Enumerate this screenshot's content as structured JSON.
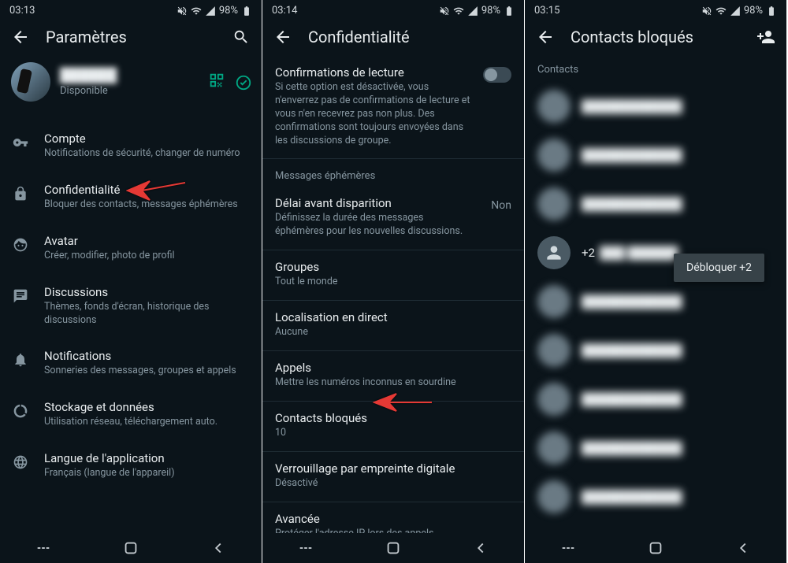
{
  "screen1": {
    "time": "03:13",
    "battery": "98%",
    "title": "Paramètres",
    "profile_status": "Disponible",
    "items": [
      {
        "title": "Compte",
        "sub": "Notifications de sécurité, changer de numéro"
      },
      {
        "title": "Confidentialité",
        "sub": "Bloquer des contacts, messages éphémères"
      },
      {
        "title": "Avatar",
        "sub": "Créer, modifier, photo de profil"
      },
      {
        "title": "Discussions",
        "sub": "Thèmes, fonds d'écran, historique des discussions"
      },
      {
        "title": "Notifications",
        "sub": "Sonneries des messages, groupes et appels"
      },
      {
        "title": "Stockage et données",
        "sub": "Utilisation réseau, téléchargement auto."
      },
      {
        "title": "Langue de l'application",
        "sub": "Français (langue de l'appareil)"
      }
    ]
  },
  "screen2": {
    "time": "03:14",
    "battery": "98%",
    "title": "Confidentialité",
    "read_receipts": {
      "title": "Confirmations de lecture",
      "sub": "Si cette option est désactivée, vous n'enverrez pas de confirmations de lecture et vous n'en recevrez pas non plus. Des confirmations sont toujours envoyées dans les discussions de groupe."
    },
    "ephemeral_section": "Messages éphémères",
    "disappearing": {
      "title": "Délai avant disparition",
      "sub": "Définissez la durée des messages éphémères pour les nouvelles discussions.",
      "value": "Non"
    },
    "groups": {
      "title": "Groupes",
      "sub": "Tout le monde"
    },
    "live_location": {
      "title": "Localisation en direct",
      "sub": "Aucune"
    },
    "calls": {
      "title": "Appels",
      "sub": "Mettre les numéros inconnus en sourdine"
    },
    "blocked": {
      "title": "Contacts bloqués",
      "sub": "10"
    },
    "fingerprint": {
      "title": "Verrouillage par empreinte digitale",
      "sub": "Désactivé"
    },
    "advanced": {
      "title": "Avancée",
      "sub": "Protéger l'adresse IP lors des appels"
    }
  },
  "screen3": {
    "time": "03:15",
    "battery": "98%",
    "title": "Contacts bloqués",
    "contacts_header": "Contacts",
    "visible_number": "+2",
    "tooltip": "Débloquer +2",
    "contacts": [
      {
        "num": "████████████"
      },
      {
        "num": "████████████"
      },
      {
        "num": "████████████"
      },
      {
        "num": "+2   ███ ██████"
      },
      {
        "num": "████████████"
      },
      {
        "num": "████████████"
      },
      {
        "num": "████████████"
      },
      {
        "num": "████████████"
      },
      {
        "num": "████████████"
      }
    ]
  }
}
